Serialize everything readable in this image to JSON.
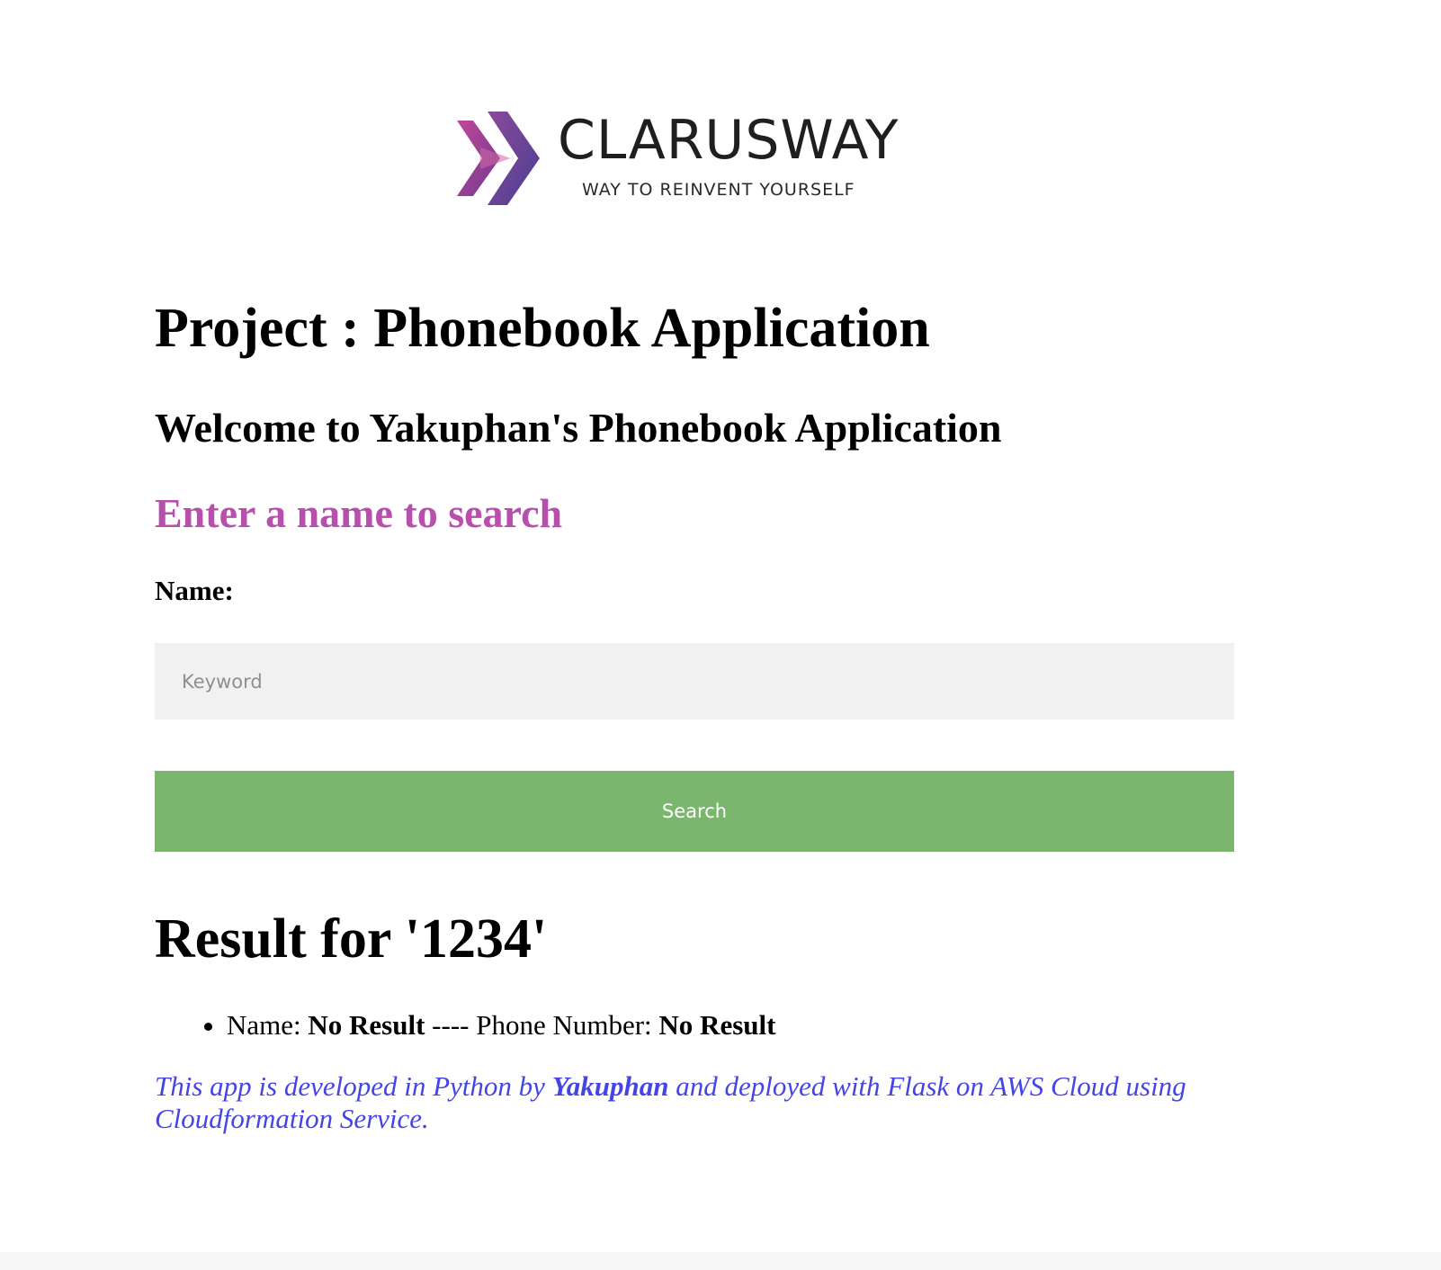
{
  "logo": {
    "brand": "CLARUSWAY",
    "tagline": "WAY TO REINVENT YOURSELF",
    "icon": "double-chevron-logo-icon",
    "colors": [
      "#6e3b8f",
      "#c0479a",
      "#4b3f92"
    ]
  },
  "title": "Project : Phonebook Application",
  "welcome": "Welcome to Yakuphan's Phonebook Application",
  "search_prompt": "Enter a name to search",
  "form": {
    "name_label": "Name:",
    "keyword_placeholder": "Keyword",
    "keyword_value": "",
    "search_button": "Search"
  },
  "results": {
    "heading": "Result for '1234'",
    "items": [
      {
        "name_label": "Name:",
        "name_value": "No Result",
        "separator": "----",
        "phone_label": "Phone Number:",
        "phone_value": "No Result"
      }
    ]
  },
  "footer": {
    "part1": "This app is developed in Python by",
    "author": "Yakuphan",
    "part2": "and deployed with Flask on AWS Cloud using Cloudformation Service",
    "end": "."
  },
  "colors": {
    "prompt": "#b84fad",
    "button": "#7ab66d",
    "footer": "#4545e6",
    "input_bg": "#f1f1f1"
  }
}
